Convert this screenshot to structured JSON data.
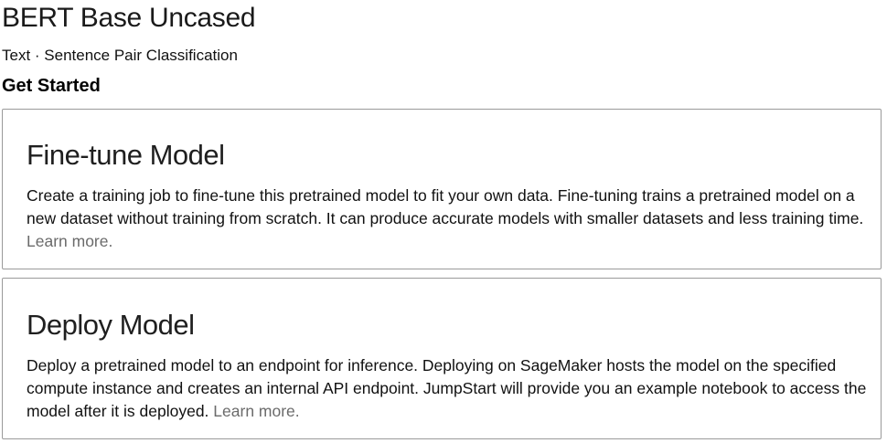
{
  "header": {
    "title": "BERT Base Uncased",
    "subtitle": "Text · Sentence Pair Classification",
    "section_heading": "Get Started"
  },
  "cards": [
    {
      "title": "Fine-tune Model",
      "description": "Create a training job to fine-tune this pretrained model to fit your own data. Fine-tuning trains a pretrained model on a new dataset without training from scratch. It can produce accurate models with smaller datasets and less training time.",
      "link_label": "Learn more."
    },
    {
      "title": "Deploy Model",
      "description": "Deploy a pretrained model to an endpoint for inference. Deploying on SageMaker hosts the model on the specified compute instance and creates an internal API endpoint. JumpStart will provide you an example notebook to access the model after it is deployed.",
      "link_label": "Learn more."
    }
  ]
}
